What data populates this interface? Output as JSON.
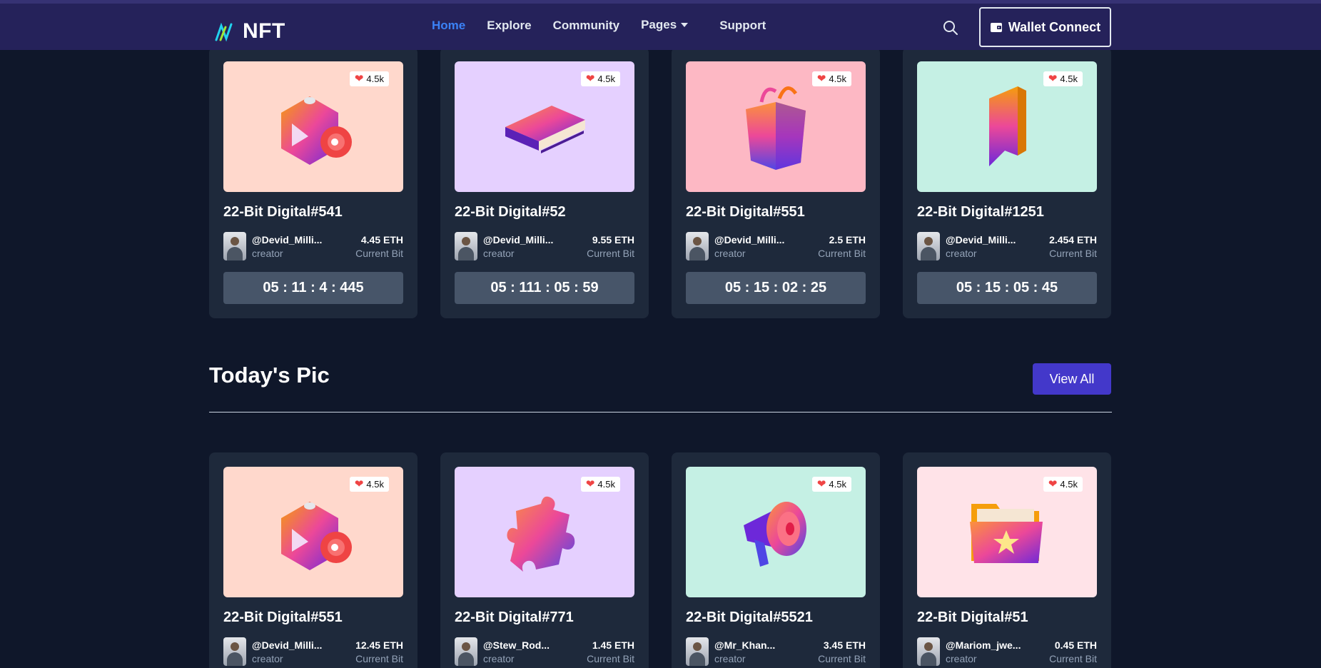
{
  "nav": {
    "brand": "NFT",
    "items": [
      {
        "label": "Home",
        "active": true
      },
      {
        "label": "Explore",
        "active": false
      },
      {
        "label": "Community",
        "active": false
      },
      {
        "label": "Pages",
        "active": false,
        "dropdown": true
      },
      {
        "label": "Support",
        "active": false
      }
    ],
    "wallet_label": "Wallet Connect"
  },
  "top_cards": [
    {
      "title": "22-Bit Digital#541",
      "likes": "4.5k",
      "creator": "@Devid_Milli...",
      "role": "creator",
      "price": "4.45 ETH",
      "price_label": "Current Bit",
      "timer": "05 : 11 : 4 : 445",
      "bg": "#ffd8cc",
      "icon": "video-cube-icon"
    },
    {
      "title": "22-Bit Digital#52",
      "likes": "4.5k",
      "creator": "@Devid_Milli...",
      "role": "creator",
      "price": "9.55 ETH",
      "price_label": "Current Bit",
      "timer": "05 : 111 : 05 : 59",
      "bg": "#e5d0ff",
      "icon": "book-icon"
    },
    {
      "title": "22-Bit Digital#551",
      "likes": "4.5k",
      "creator": "@Devid_Milli...",
      "role": "creator",
      "price": "2.5 ETH",
      "price_label": "Current Bit",
      "timer": "05 : 15 : 02 : 25",
      "bg": "#fdb8c4",
      "icon": "shopping-bag-icon"
    },
    {
      "title": "22-Bit Digital#1251",
      "likes": "4.5k",
      "creator": "@Devid_Milli...",
      "role": "creator",
      "price": "2.454 ETH",
      "price_label": "Current Bit",
      "timer": "05 : 15 : 05 : 45",
      "bg": "#c5f0e4",
      "icon": "bookmark-icon"
    }
  ],
  "section": {
    "title": "Today's Pic",
    "view_all": "View All"
  },
  "bottom_cards": [
    {
      "title": "22-Bit Digital#551",
      "likes": "4.5k",
      "creator": "@Devid_Milli...",
      "role": "creator",
      "price": "12.45 ETH",
      "price_label": "Current Bit",
      "bg": "#ffd8cc",
      "icon": "video-cube-icon"
    },
    {
      "title": "22-Bit Digital#771",
      "likes": "4.5k",
      "creator": "@Stew_Rod...",
      "role": "creator",
      "price": "1.45 ETH",
      "price_label": "Current Bit",
      "bg": "#e5d0ff",
      "icon": "puzzle-piece-icon"
    },
    {
      "title": "22-Bit Digital#5521",
      "likes": "4.5k",
      "creator": "@Mr_Khan...",
      "role": "creator",
      "price": "3.45 ETH",
      "price_label": "Current Bit",
      "bg": "#c5f0e4",
      "icon": "megaphone-icon"
    },
    {
      "title": "22-Bit Digital#51",
      "likes": "4.5k",
      "creator": "@Mariom_jwe...",
      "role": "creator",
      "price": "0.45 ETH",
      "price_label": "Current Bit",
      "bg": "#ffe3e8",
      "icon": "star-folder-icon"
    }
  ]
}
